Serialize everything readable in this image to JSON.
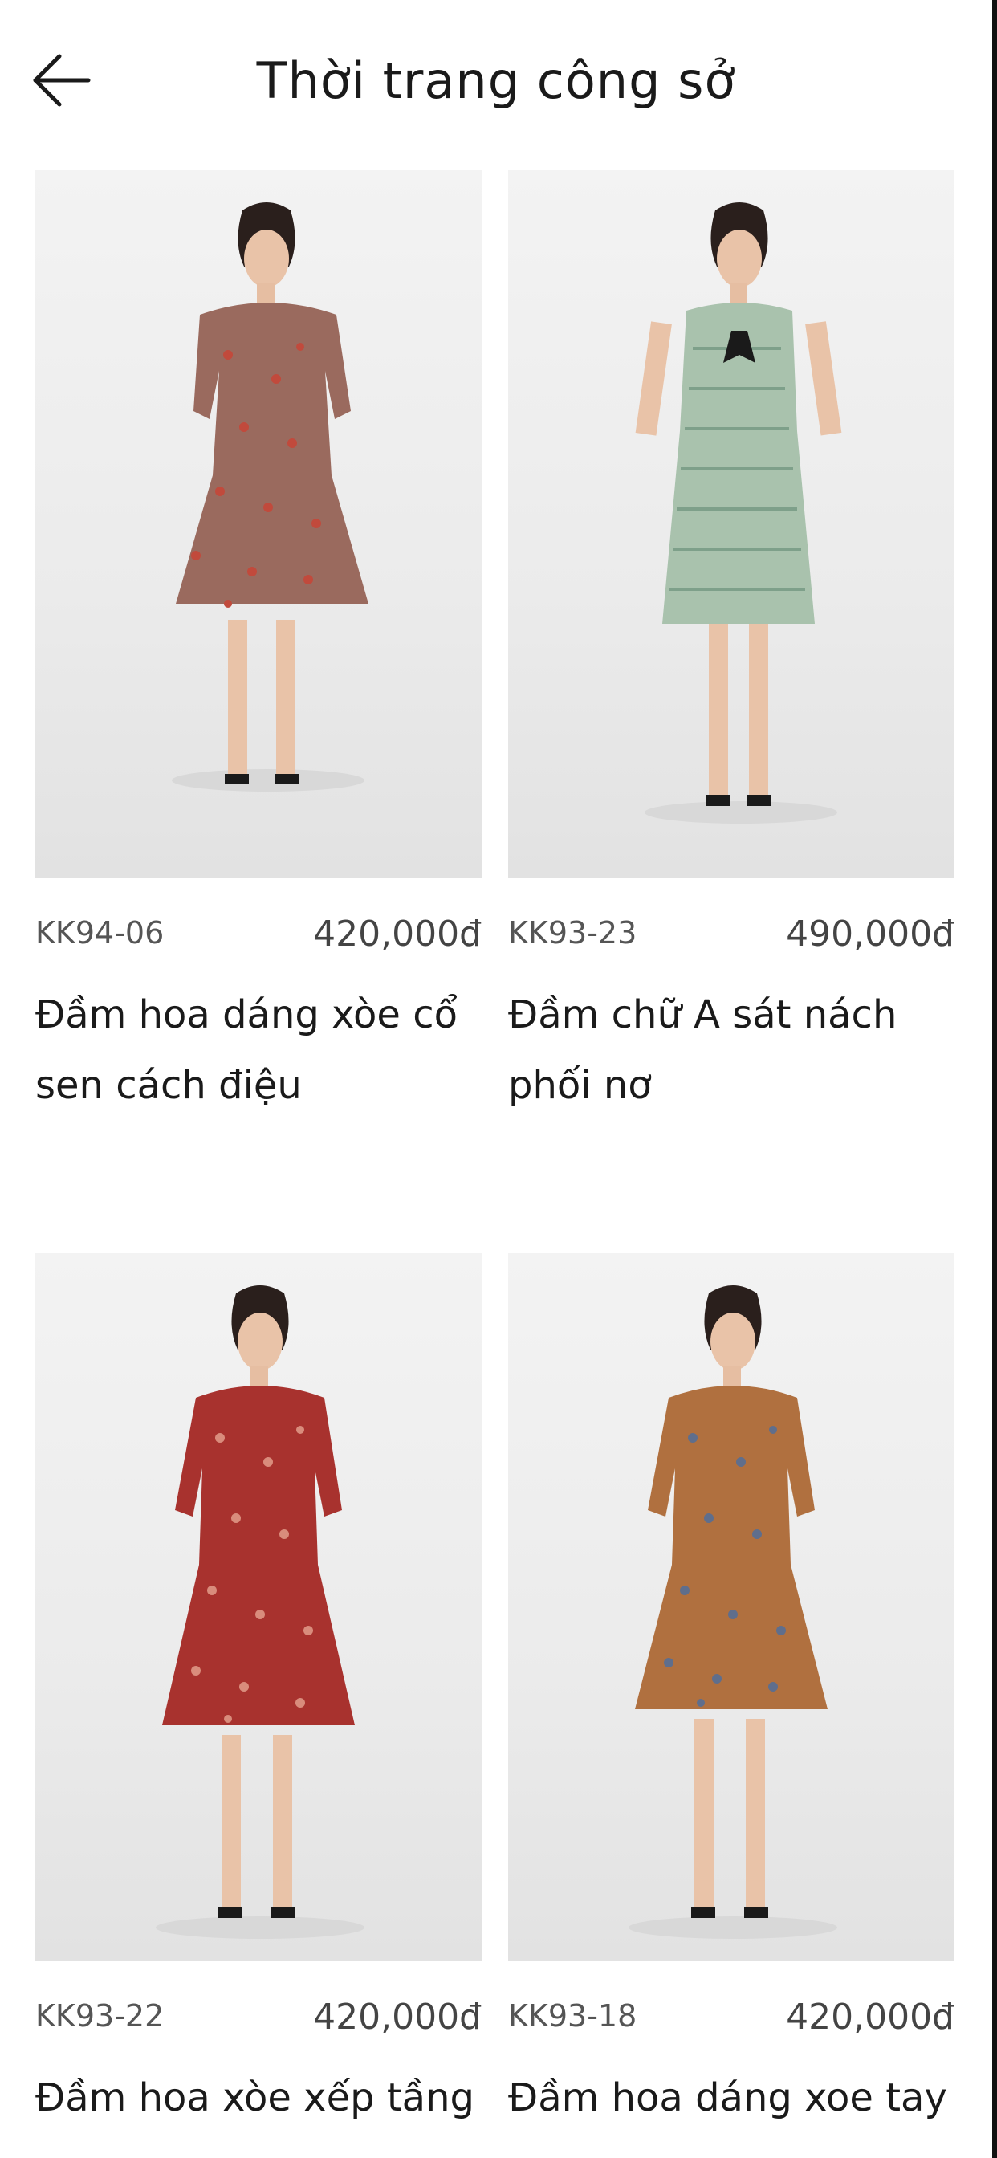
{
  "header": {
    "title": "Thời trang công sở",
    "back_icon": "arrow-left-icon"
  },
  "products": [
    {
      "code": "KK94-06",
      "price": "420,000đ",
      "name": "Đầm hoa dáng xòe cổ sen cách điệu",
      "dress_color": "#9a6a5e",
      "pattern_color": "#c14a3c"
    },
    {
      "code": "KK93-23",
      "price": "490,000đ",
      "name": "Đầm chữ A sát nách phối nơ",
      "dress_color": "#a9c2ad",
      "pattern_color": "#7ea08a"
    },
    {
      "code": "KK93-22",
      "price": "420,000đ",
      "name": "Đầm hoa xòe xếp tầng",
      "dress_color": "#a8322e",
      "pattern_color": "#d98c7c"
    },
    {
      "code": "KK93-18",
      "price": "420,000đ",
      "name": "Đầm hoa dáng xoe tay",
      "dress_color": "#b0703f",
      "pattern_color": "#5f6e8c"
    }
  ]
}
